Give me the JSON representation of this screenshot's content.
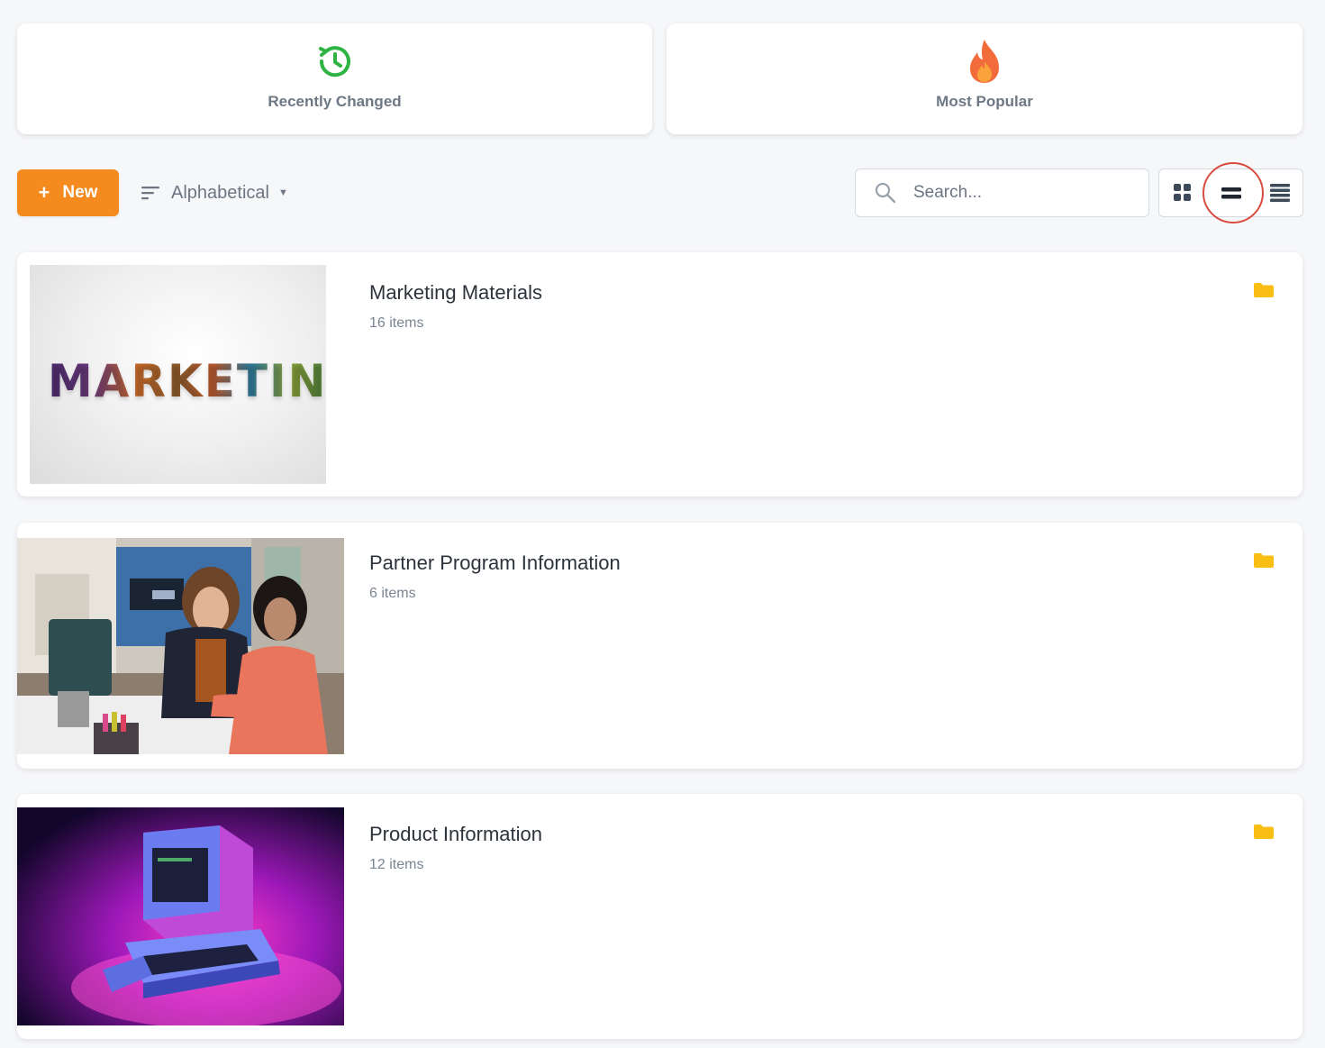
{
  "shortcuts": {
    "recent": {
      "label": "Recently Changed",
      "icon": "history-clock-icon",
      "color": "#2fb344"
    },
    "popular": {
      "label": "Most Popular",
      "icon": "flame-icon",
      "color": "#f26b3a"
    }
  },
  "toolbar": {
    "new_label": "New",
    "sort_label": "Alphabetical",
    "search_placeholder": "Search...",
    "views": [
      "grid-view-icon",
      "row-view-icon",
      "list-view-icon"
    ],
    "active_view": "row-view-icon",
    "accent": "#f58a1f"
  },
  "folders": [
    {
      "title": "Marketing Materials",
      "count": "16 items",
      "thumb_text": "MARKETING",
      "icon": "folder-icon"
    },
    {
      "title": "Partner Program Information",
      "count": "6 items",
      "icon": "folder-icon"
    },
    {
      "title": "Product Information",
      "count": "12 items",
      "icon": "folder-icon"
    }
  ],
  "folder_icon_color": "#f9be14"
}
